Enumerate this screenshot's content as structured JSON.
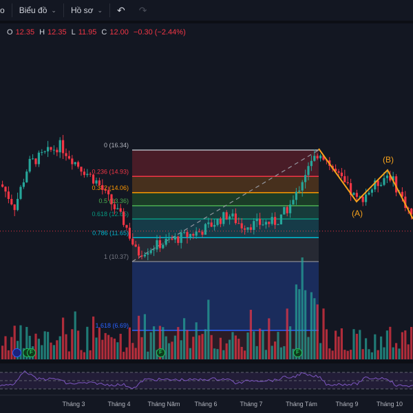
{
  "toolbar": {
    "partial_label": "o",
    "chart_label": "Biểu đồ",
    "profile_label": "Hồ sơ",
    "undo_icon": "undo-icon",
    "redo_icon": "redo-icon"
  },
  "legend": {
    "o_key": "O",
    "o": "12.35",
    "h_key": "H",
    "h": "12.35",
    "l_key": "L",
    "l": "11.95",
    "c_key": "C",
    "c": "12.00",
    "change": "−0.30 (−2.44%)"
  },
  "colors": {
    "up": "#26a69a",
    "down": "#f23645",
    "background": "#131722",
    "wave": "#f7a21b",
    "rsi": "#7e57c2"
  },
  "fib": {
    "levels": [
      {
        "label": "0 (16.34)",
        "ratio": 0,
        "price": 16.34,
        "color": "#b2b5be"
      },
      {
        "label": "0.236 (14.93)",
        "ratio": 0.236,
        "price": 14.93,
        "color": "#f23645"
      },
      {
        "label": "0.382 (14.06)",
        "ratio": 0.382,
        "price": 14.06,
        "color": "#ff9800"
      },
      {
        "label": "0.5 (13.36)",
        "ratio": 0.5,
        "price": 13.36,
        "color": "#4caf50"
      },
      {
        "label": "0.618 (12.65)",
        "ratio": 0.618,
        "price": 12.65,
        "color": "#089981"
      },
      {
        "label": "0.786 (11.65)",
        "ratio": 0.786,
        "price": 11.65,
        "color": "#00bcd4"
      },
      {
        "label": "1 (10.37)",
        "ratio": 1,
        "price": 10.37,
        "color": "#787b86"
      },
      {
        "label": "1.618 (6.69)",
        "ratio": 1.618,
        "price": 6.69,
        "color": "#2962ff"
      }
    ]
  },
  "waves": {
    "a": "(A)",
    "b": "(B)"
  },
  "markers": [
    "F",
    "F",
    "F"
  ],
  "time_axis": [
    "Tháng 3",
    "Tháng 4",
    "Tháng Năm",
    "Tháng 6",
    "Tháng 7",
    "Tháng Tám",
    "Tháng 9",
    "Tháng 10"
  ],
  "last_price": 12.0
}
